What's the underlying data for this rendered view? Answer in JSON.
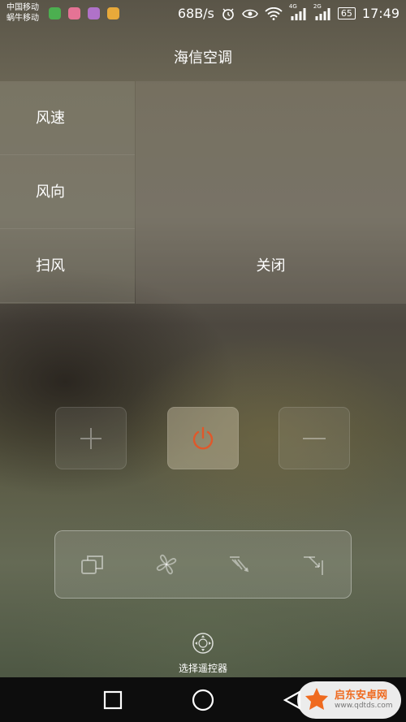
{
  "status": {
    "carrier_line1": "中国移动",
    "carrier_line2": "蜗牛移动",
    "speed": "68B/s",
    "signal1_tag": "4G",
    "signal2_tag": "2G",
    "battery": "65",
    "time": "17:49"
  },
  "header": {
    "title": "海信空调"
  },
  "menu": {
    "items": [
      {
        "label": "风速"
      },
      {
        "label": "风向"
      },
      {
        "label": "扫风"
      }
    ],
    "selected_value": "关闭"
  },
  "controls": {
    "plus_icon": "plus-icon",
    "power_icon": "power-icon",
    "minus_icon": "minus-icon",
    "power_color": "#e0582a"
  },
  "modes": [
    "window-mode-icon",
    "fan-icon",
    "swing-icon",
    "direction-icon"
  ],
  "remote": {
    "label": "选择遥控器"
  },
  "watermark": {
    "name": "启东安卓网",
    "url": "www.qdtds.com"
  }
}
